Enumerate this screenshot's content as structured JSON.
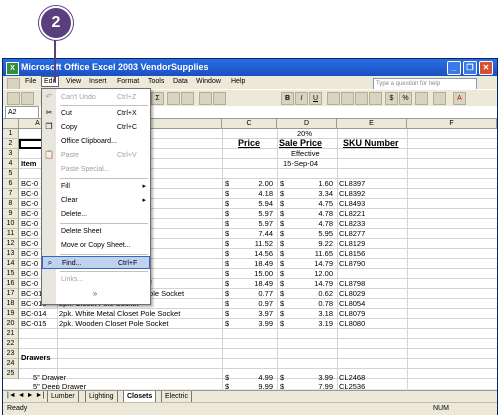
{
  "callout": {
    "number": "2"
  },
  "window": {
    "title": "Microsoft Office Excel 2003 VendorSupplies",
    "app_icon": "X",
    "minimize": "_",
    "restore": "❐",
    "close": "✕"
  },
  "menubar": {
    "items": [
      "File",
      "Edit",
      "View",
      "Insert",
      "Format",
      "Tools",
      "Data",
      "Window",
      "Help"
    ],
    "help_placeholder": "Type a question for help"
  },
  "toolbar": {
    "bold": "B",
    "italic": "I",
    "underline": "U",
    "sum": "Σ",
    "dollar": "$",
    "percent": "%",
    "font_color": "A"
  },
  "formula_bar": {
    "name_box": "A2",
    "fx": "fx"
  },
  "columns": [
    "A",
    "B",
    "C",
    "D",
    "E",
    "F"
  ],
  "rows": [
    "1",
    "2",
    "3",
    "4",
    "5",
    "6",
    "7",
    "8",
    "9",
    "10",
    "11",
    "12",
    "13",
    "14",
    "15",
    "16",
    "17",
    "18",
    "19",
    "20",
    "21",
    "22",
    "23",
    "24",
    "25"
  ],
  "sheet": {
    "d1": "20%",
    "c2": "Price",
    "d2": "Sale Price",
    "e2": "SKU Number",
    "d3": "Effective",
    "d4": "15-Sep-04",
    "a4": "Item",
    "data_rows": [
      {
        "a": "BC-0",
        "b": "et Rod",
        "c": "2.00",
        "d": "1.60",
        "e": "CL8397"
      },
      {
        "a": "BC-0",
        "b": "et Rod",
        "c": "4.18",
        "d": "3.34",
        "e": "CL8392"
      },
      {
        "a": "BC-0",
        "b": "",
        "c": "5.94",
        "d": "4.75",
        "e": "CL8493"
      },
      {
        "a": "BC-0",
        "b": "le Closet Pole",
        "c": "5.97",
        "d": "4.78",
        "e": "CL8221"
      },
      {
        "a": "BC-0",
        "b": "le Closet Pole",
        "c": "5.97",
        "d": "4.78",
        "e": "CL8233"
      },
      {
        "a": "BC-0",
        "b": "le Closet Pole",
        "c": "7.44",
        "d": "5.95",
        "e": "CL8277"
      },
      {
        "a": "BC-0",
        "b": "nsion Rod",
        "c": "11.52",
        "d": "9.22",
        "e": "CL8129"
      },
      {
        "a": "BC-0",
        "b": "nsion Rod",
        "c": "14.56",
        "d": "11.65",
        "e": "CL8156"
      },
      {
        "a": "BC-0",
        "b": "nsion Rod",
        "c": "18.49",
        "d": "14.79",
        "e": "CL8790"
      },
      {
        "a": "BC-0",
        "b": "tal",
        "c": "15.00",
        "d": "12.00",
        "e": ""
      },
      {
        "a": "BC-0",
        "b": "8\" x 8\" Almond Corner Shelf",
        "c": "18.49",
        "d": "14.79",
        "e": "CL8798"
      },
      {
        "a": "BC-012",
        "b": "2pk. White Plastic Closet Pole Socket",
        "c": "0.77",
        "d": "0.62",
        "e": "CL8029"
      },
      {
        "a": "BC-013",
        "b": "2pk. Closet Pole Socket",
        "c": "0.97",
        "d": "0.78",
        "e": "CL8054"
      },
      {
        "a": "BC-014",
        "b": "2pk. White Metal Closet Pole Socket",
        "c": "3.97",
        "d": "3.18",
        "e": "CL8079"
      },
      {
        "a": "BC-015",
        "b": "2pk. Wooden Closet Pole Socket",
        "c": "3.99",
        "d": "3.19",
        "e": "CL8080"
      }
    ],
    "a22": "Drawers",
    "a24": "5\" Drawer",
    "c24": "4.99",
    "d24": "3.99",
    "e24": "CL2468",
    "a25": "5\" Deep Drawer",
    "c25": "9.99",
    "d25": "7.99",
    "e25": "CL2536",
    "dollar": "$"
  },
  "edit_menu": {
    "undo": {
      "label": "Can't Undo",
      "shortcut": "Ctrl+Z"
    },
    "cut": {
      "label": "Cut",
      "shortcut": "Ctrl+X"
    },
    "copy": {
      "label": "Copy",
      "shortcut": "Ctrl+C"
    },
    "clipboard": {
      "label": "Office Clipboard..."
    },
    "paste": {
      "label": "Paste",
      "shortcut": "Ctrl+V"
    },
    "paste_special": {
      "label": "Paste Special..."
    },
    "fill": {
      "label": "Fill"
    },
    "clear": {
      "label": "Clear"
    },
    "delete": {
      "label": "Delete..."
    },
    "delete_sheet": {
      "label": "Delete Sheet"
    },
    "move_copy": {
      "label": "Move or Copy Sheet..."
    },
    "find": {
      "label": "Find...",
      "shortcut": "Ctrl+F"
    },
    "links": {
      "label": "Links..."
    },
    "expand": "»"
  },
  "tabs": {
    "nav": "|◄ ◄ ► ►|",
    "items": [
      "Lumber",
      "Lighting",
      "Closets",
      "Electric"
    ]
  },
  "status": {
    "left": "Ready",
    "right": "NUM"
  }
}
